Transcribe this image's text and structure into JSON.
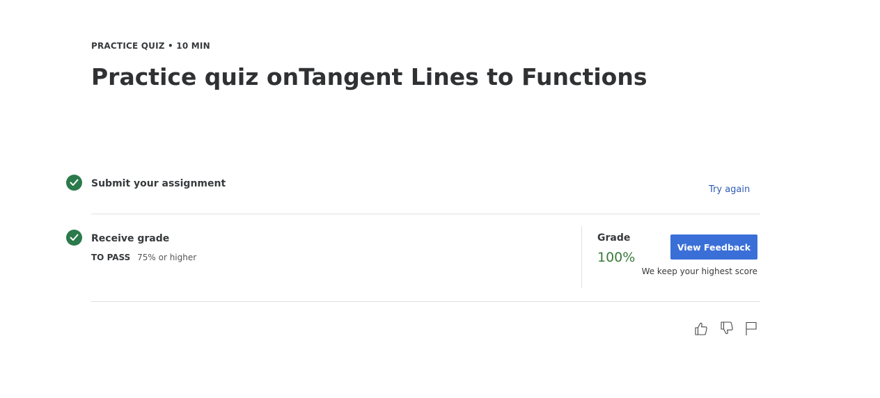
{
  "header": {
    "eyebrow": "PRACTICE QUIZ • 10 MIN",
    "title": "Practice quiz onTangent Lines to Functions"
  },
  "steps": {
    "submit": {
      "title": "Submit your assignment",
      "action": "Try again"
    },
    "receive": {
      "title": "Receive grade",
      "to_pass_label": "TO PASS",
      "to_pass_value": "75% or higher"
    }
  },
  "grade": {
    "label": "Grade",
    "value": "100%",
    "button": "View Feedback",
    "note": "We keep your highest score"
  },
  "feedback_icons": [
    "thumbs-up-icon",
    "thumbs-down-icon",
    "flag-icon"
  ],
  "colors": {
    "check_green": "#2b7a4b",
    "grade_green": "#3b7a3b",
    "link_blue": "#2d5bb5",
    "button_blue": "#3a6fd8"
  }
}
